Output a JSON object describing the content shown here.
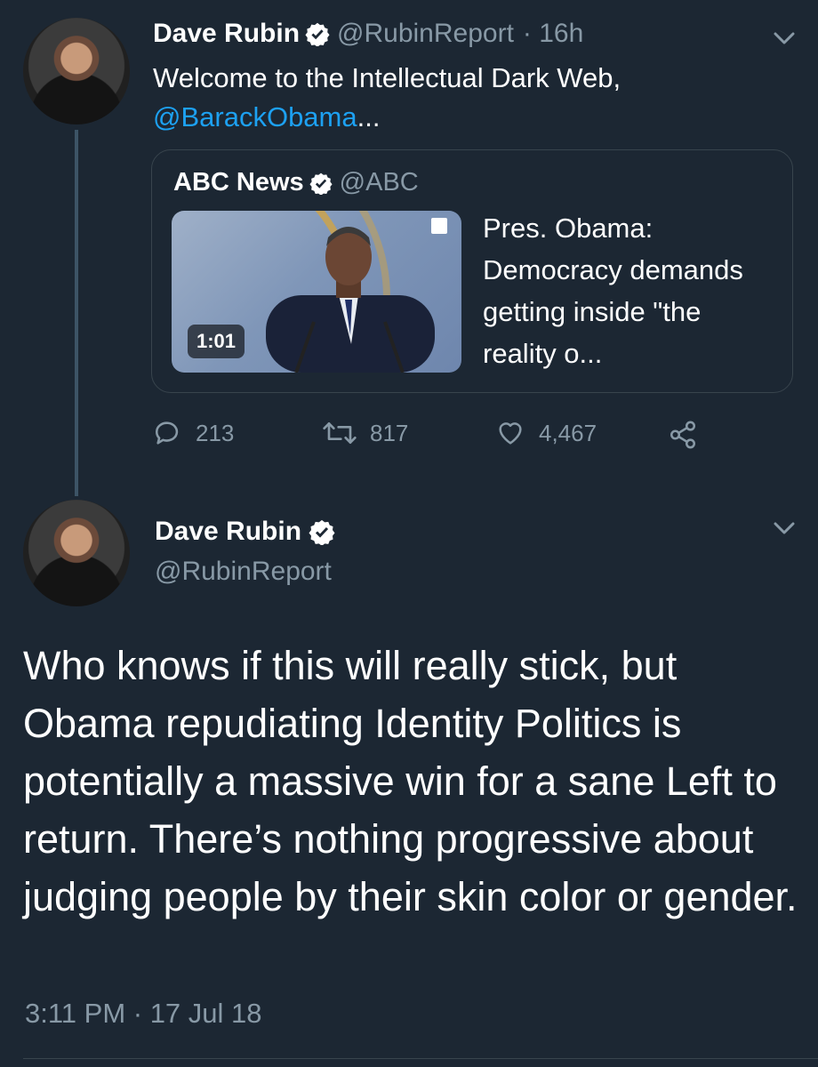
{
  "tweet1": {
    "name": "Dave Rubin",
    "handle": "@RubinReport",
    "time": "· 16h",
    "text_line1": "Welcome to the Intellectual Dark Web,",
    "mention": "@BarackObama",
    "ellipsis": "...",
    "quote": {
      "name": "ABC News",
      "handle": "@ABC",
      "video_duration": "1:01",
      "text": "Pres. Obama: Democracy demands getting inside \"the reality o..."
    },
    "actions": {
      "replies": "213",
      "retweets": "817",
      "likes": "4,467"
    }
  },
  "tweet2": {
    "name": "Dave Rubin",
    "handle": "@RubinReport",
    "text": "Who knows if this will really stick, but Obama repudiating Identity Politics is potentially a massive win for a sane Left to return. There’s nothing progressive about judging people by their skin color or gender.",
    "timestamp": "3:11 PM · 17 Jul 18"
  },
  "icons": {
    "verified": "verified-badge-icon",
    "reply": "reply-icon",
    "retweet": "retweet-icon",
    "like": "heart-icon",
    "share": "share-icon",
    "menu": "chevron-down-icon"
  },
  "colors": {
    "background": "#1c2733",
    "link": "#1da1f2",
    "muted": "#8899a6"
  }
}
